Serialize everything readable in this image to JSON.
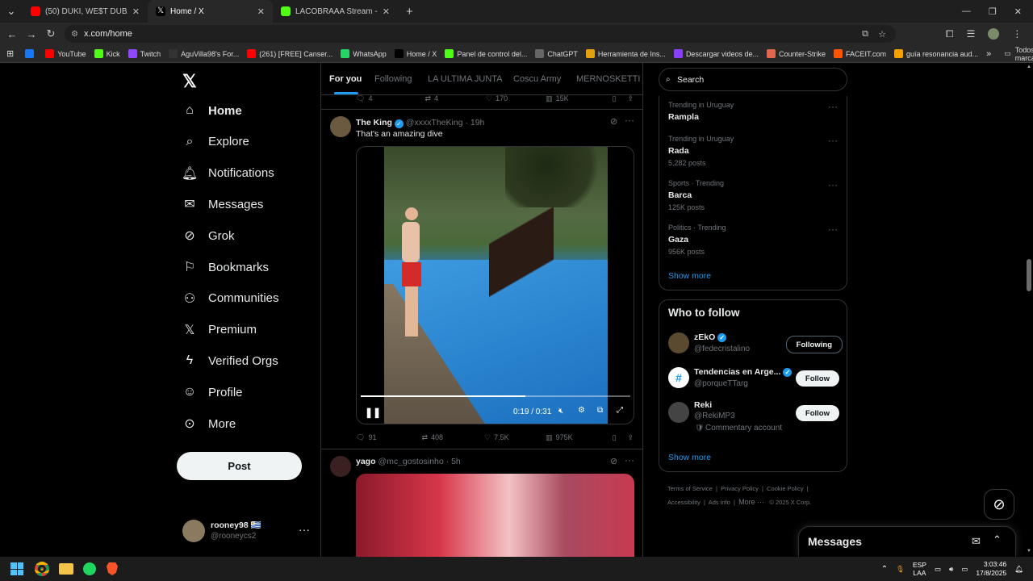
{
  "browser": {
    "tabs": [
      {
        "title": "(50) DUKI, WE$T DUBAI - cONT",
        "color": "#ff0000"
      },
      {
        "title": "Home / X",
        "color": "#000000"
      },
      {
        "title": "LACOBRAAA Stream - Watch Li",
        "color": "#53fc18"
      }
    ],
    "new_tab": "+",
    "url": "x.com/home",
    "bookmarks": [
      {
        "label": "",
        "color": "#1877f2"
      },
      {
        "label": "YouTube",
        "color": "#ff0000"
      },
      {
        "label": "Kick",
        "color": "#53fc18"
      },
      {
        "label": "Twitch",
        "color": "#9146ff"
      },
      {
        "label": "AguVilla98's For...",
        "color": "#333333"
      },
      {
        "label": "(261) [FREE] Canser...",
        "color": "#ff0000"
      },
      {
        "label": "WhatsApp",
        "color": "#25d366"
      },
      {
        "label": "Home / X",
        "color": "#000000"
      },
      {
        "label": "Panel de control del...",
        "color": "#53fc18"
      },
      {
        "label": "ChatGPT",
        "color": "#666666"
      },
      {
        "label": "Herramienta de Ins...",
        "color": "#e5a00d"
      },
      {
        "label": "Descargar videos de...",
        "color": "#8a3ffc"
      },
      {
        "label": "Counter-Strike",
        "color": "#e0664d"
      },
      {
        "label": "FACEIT.com",
        "color": "#ff5500"
      },
      {
        "label": "guía resonancia aud...",
        "color": "#f4a100"
      }
    ],
    "more_bookmarks": "»",
    "all_bookmarks": "Todos los marcadores"
  },
  "nav": {
    "items": [
      {
        "label": "Home",
        "icon": "home-icon"
      },
      {
        "label": "Explore",
        "icon": "search-icon"
      },
      {
        "label": "Notifications",
        "icon": "bell-icon"
      },
      {
        "label": "Messages",
        "icon": "mail-icon"
      },
      {
        "label": "Grok",
        "icon": "grok-icon"
      },
      {
        "label": "Bookmarks",
        "icon": "bookmark-icon"
      },
      {
        "label": "Communities",
        "icon": "people-icon"
      },
      {
        "label": "Premium",
        "icon": "x-icon"
      },
      {
        "label": "Verified Orgs",
        "icon": "bolt-icon"
      },
      {
        "label": "Profile",
        "icon": "person-icon"
      },
      {
        "label": "More",
        "icon": "more-icon"
      }
    ],
    "post_label": "Post",
    "account": {
      "name": "rooney98 🇺🇾",
      "handle": "@rooneycs2"
    }
  },
  "feed": {
    "tabs": [
      "For you",
      "Following",
      "LA ULTIMA JUNTA",
      "Coscu Army",
      "MERNOSKETTI"
    ],
    "prev_actions": {
      "replies": "4",
      "reposts": "4",
      "likes": "170",
      "views": "15K"
    },
    "tweets": [
      {
        "name": "The King",
        "handle": "@xxxxTheKing",
        "time": "· 19h",
        "text": "That's an amazing dive",
        "video_time": "0:19 / 0:31",
        "progress": 0.61,
        "replies": "91",
        "reposts": "408",
        "likes": "7.5K",
        "views": "975K"
      },
      {
        "name": "yago",
        "handle": "@mc_gostosinho",
        "time": "· 5h"
      }
    ]
  },
  "sidebar": {
    "search_placeholder": "Search",
    "trends": [
      {
        "context": "Trending in Uruguay",
        "name": "Rampla",
        "count": ""
      },
      {
        "context": "Trending in Uruguay",
        "name": "Rada",
        "count": "5,282 posts"
      },
      {
        "context": "Sports · Trending",
        "name": "Barca",
        "count": "125K posts"
      },
      {
        "context": "Politics · Trending",
        "name": "Gaza",
        "count": "956K posts"
      }
    ],
    "show_more": "Show more",
    "who_to_follow": {
      "title": "Who to follow",
      "accounts": [
        {
          "name": "zEkO",
          "handle": "@fedecristalino",
          "button": "Following",
          "extra": ""
        },
        {
          "name": "Tendencias en Arge...",
          "handle": "@porqueTTarg",
          "button": "Follow",
          "extra": ""
        },
        {
          "name": "Reki",
          "handle": "@RekiMP3",
          "button": "Follow",
          "extra": "Commentary account"
        }
      ],
      "show_more": "Show more"
    },
    "footer": {
      "links": [
        "Terms of Service",
        "Privacy Policy",
        "Cookie Policy",
        "Accessibility",
        "Ads info",
        "More ···"
      ],
      "copyright": "© 2025 X Corp."
    },
    "messages_label": "Messages"
  },
  "taskbar": {
    "lang": "ESP",
    "lang2": "LAA",
    "time": "3:03:46",
    "date": "17/8/2025"
  }
}
